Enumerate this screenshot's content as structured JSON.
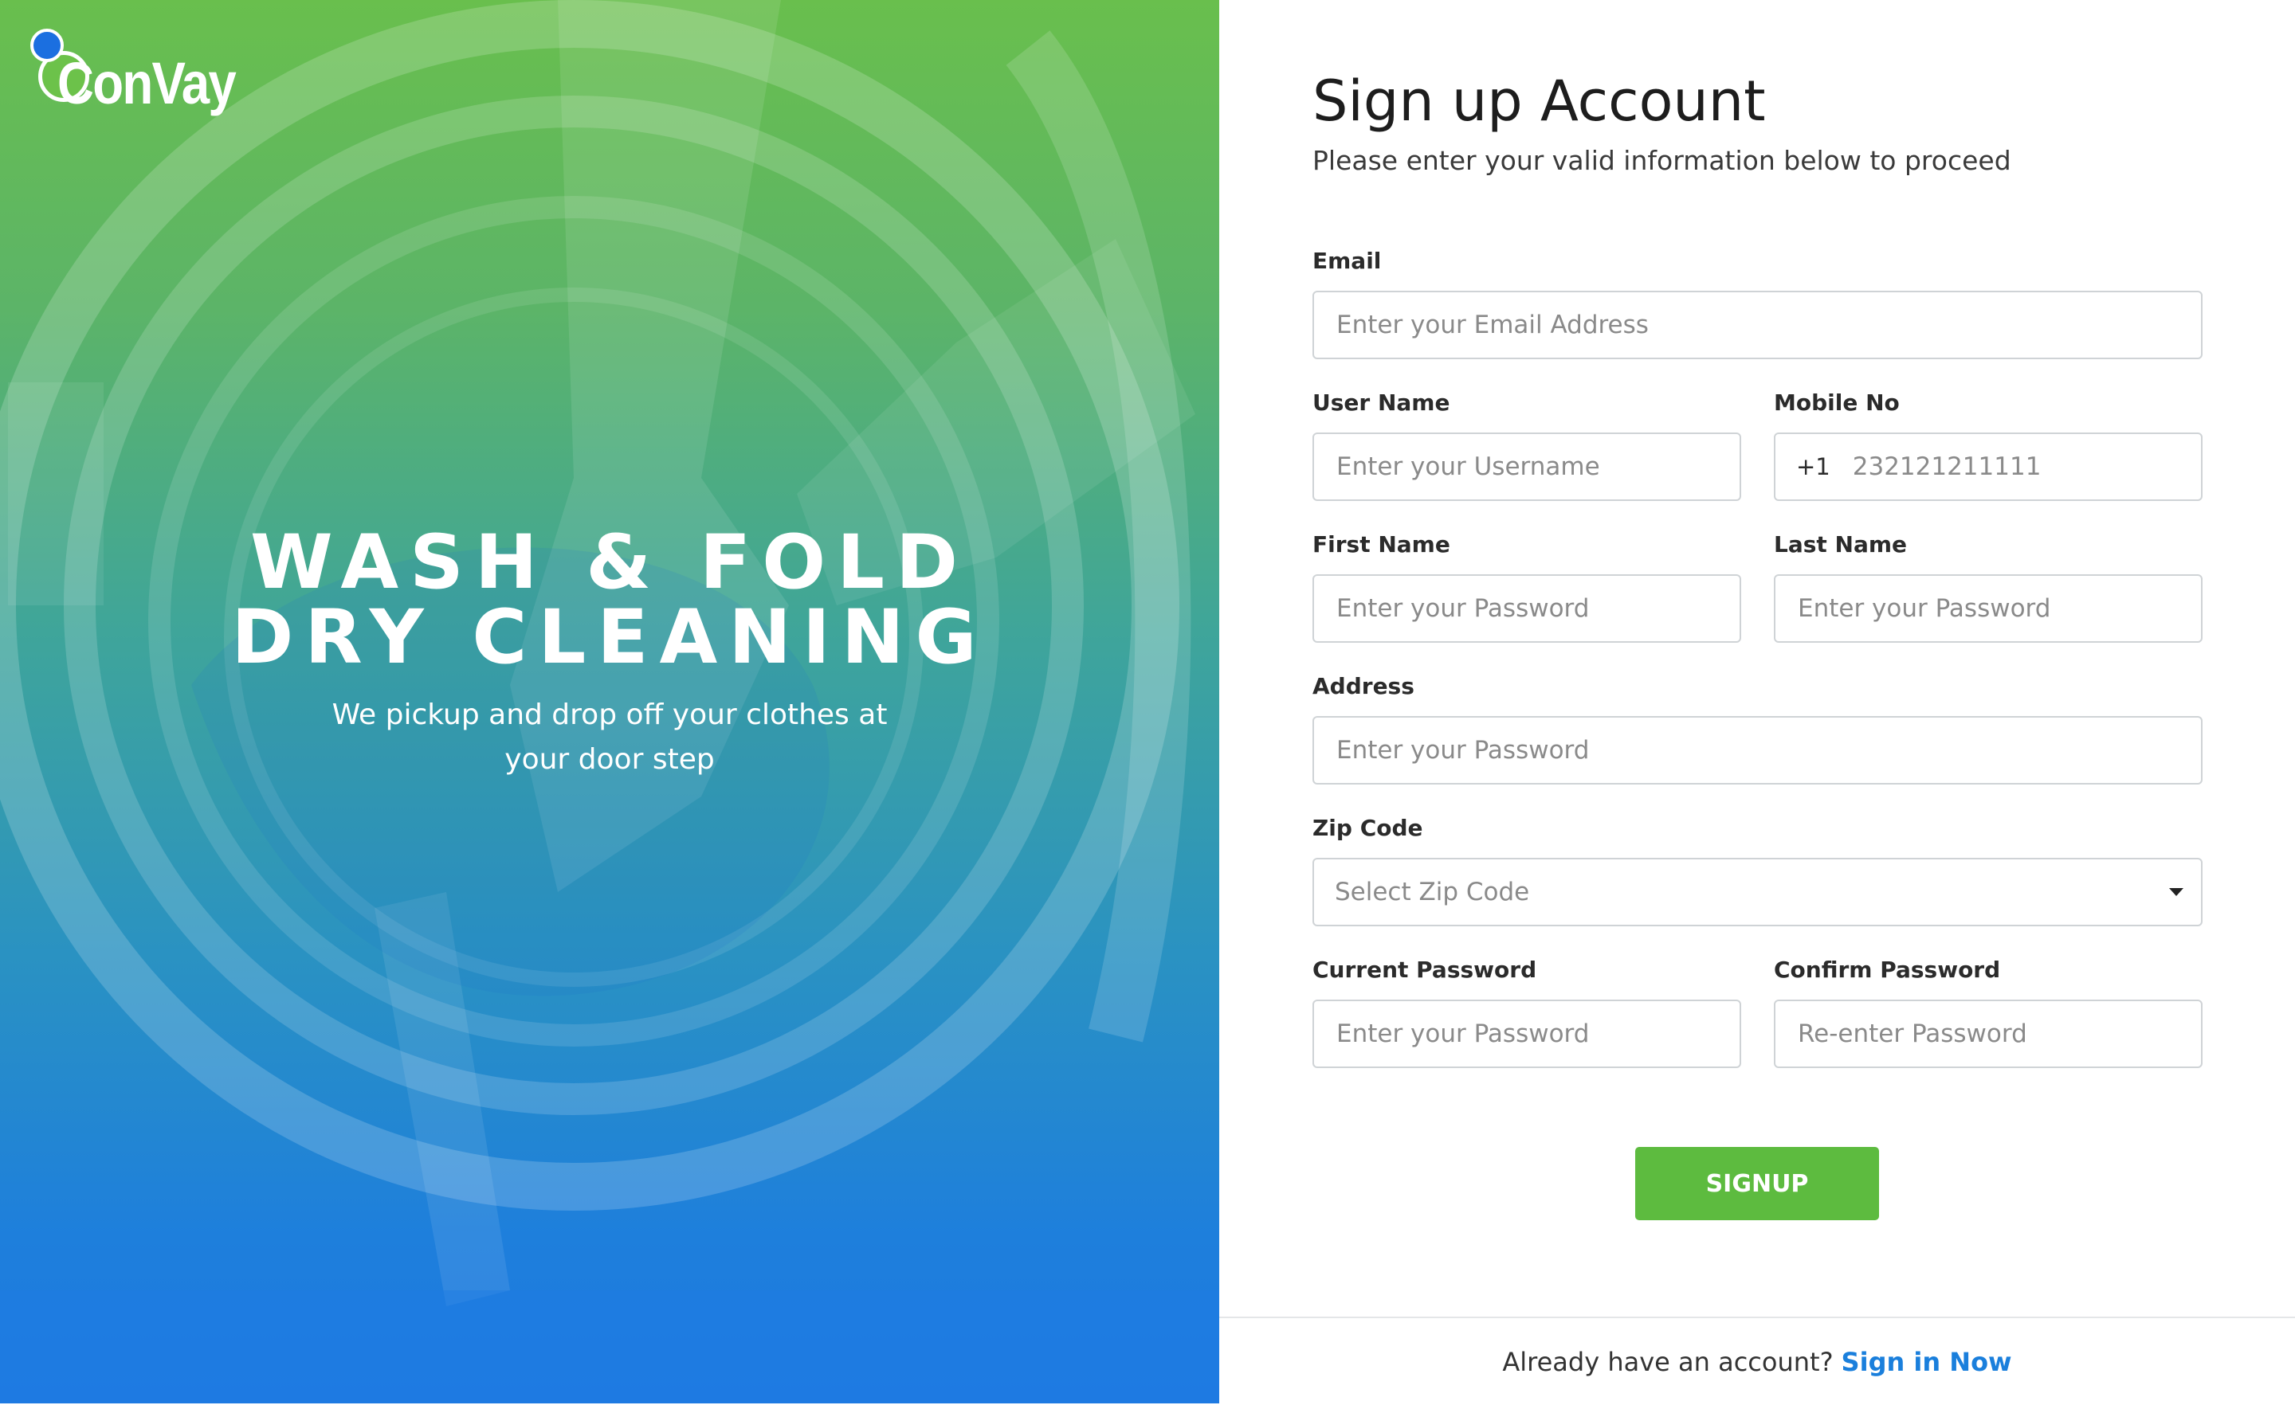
{
  "brand": {
    "name": "ConVay"
  },
  "hero": {
    "title_line1": "WASH & FOLD",
    "title_line2": "DRY CLEANING",
    "subtitle": "We pickup and drop off your clothes at your door step"
  },
  "form": {
    "title": "Sign up Account",
    "subtitle": "Please enter your valid information below to proceed",
    "email": {
      "label": "Email",
      "placeholder": "Enter your Email Address"
    },
    "username": {
      "label": "User Name",
      "placeholder": "Enter your Username"
    },
    "mobile": {
      "label": "Mobile No",
      "prefix": "+1",
      "placeholder": "232121211111"
    },
    "first_name": {
      "label": "First Name",
      "placeholder": "Enter your Password"
    },
    "last_name": {
      "label": "Last Name",
      "placeholder": "Enter your Password"
    },
    "address": {
      "label": "Address",
      "placeholder": "Enter your Password"
    },
    "zip": {
      "label": "Zip Code",
      "selected": "Select Zip Code"
    },
    "current_password": {
      "label": "Current Password",
      "placeholder": "Enter your Password"
    },
    "confirm_password": {
      "label": "Confirm Password",
      "placeholder": "Re-enter Password"
    },
    "submit_label": "SIGNUP"
  },
  "footer": {
    "prompt": "Already have an account?",
    "link": "Sign in Now"
  },
  "colors": {
    "accent_green": "#5dbb3f",
    "link_blue": "#1a7fdc",
    "brand_blue": "#1b6fe0"
  }
}
